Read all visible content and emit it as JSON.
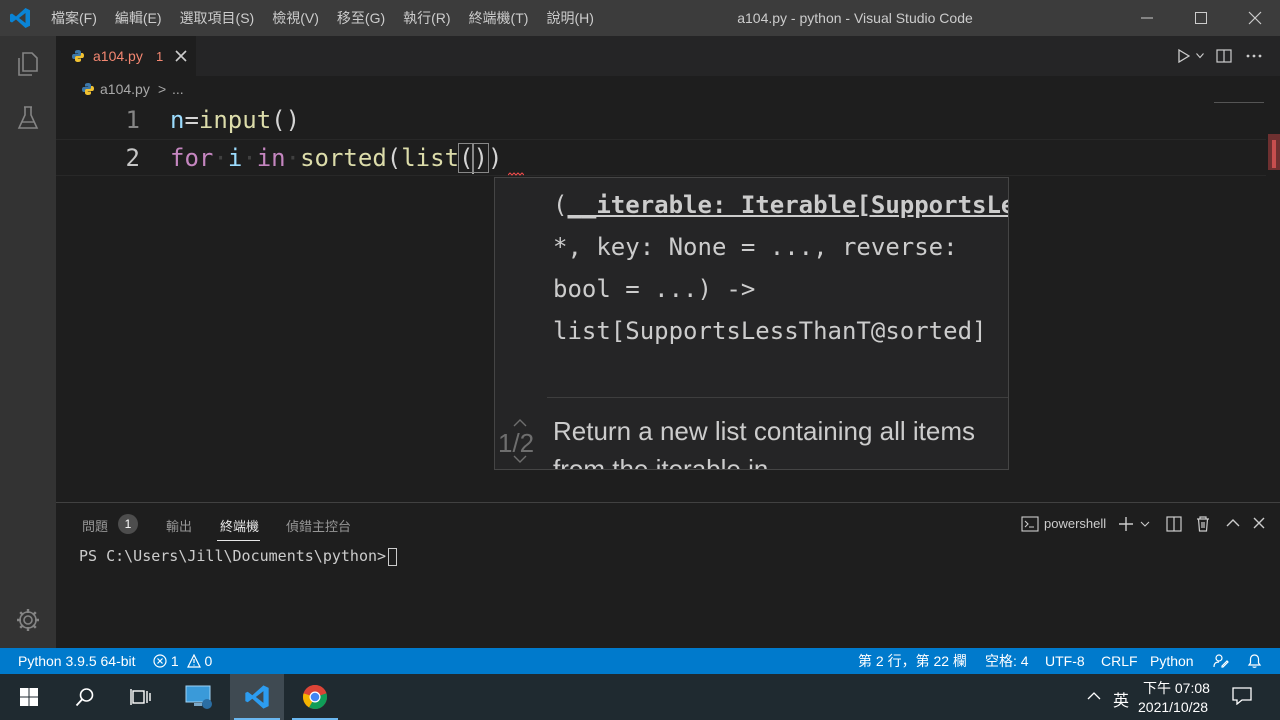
{
  "window": {
    "title": "a104.py - python - Visual Studio Code",
    "menu": [
      "檔案(F)",
      "編輯(E)",
      "選取項目(S)",
      "檢視(V)",
      "移至(G)",
      "執行(R)",
      "終端機(T)",
      "說明(H)"
    ]
  },
  "tab": {
    "filename": "a104.py",
    "problem_count": "1"
  },
  "breadcrumb": {
    "file": "a104.py",
    "separator": ">",
    "more": "..."
  },
  "editor": {
    "lines": [
      {
        "number": "1",
        "tokens": [
          {
            "t": "n",
            "c": "var"
          },
          {
            "t": "=",
            "c": ""
          },
          {
            "t": "input",
            "c": "fn"
          },
          {
            "t": "()",
            "c": ""
          }
        ]
      },
      {
        "number": "2"
      }
    ],
    "line2": {
      "kw_for": "for",
      "var_i": "i",
      "kw_in": "in",
      "fn_sorted": "sorted",
      "open1": "(",
      "fn_list": "list",
      "open2": "(",
      "close2": ")",
      "close1": ")"
    }
  },
  "signature_help": {
    "param_active": "__iterable: Iterable[SupportsLessThanT@sor",
    "line_open": "(",
    "line3": "*, key: None = ..., reverse:",
    "line4": "bool = ...) ->",
    "line5": "list[SupportsLessThanT@sorted]",
    "counter": "1/2",
    "doc": "Return a new list containing all items from the iterable in"
  },
  "panel": {
    "tabs": [
      "問題",
      "輸出",
      "終端機",
      "偵錯主控台"
    ],
    "active_tab": "終端機",
    "problems_badge": "1",
    "shell": "powershell",
    "terminal_prompt": "PS C:\\Users\\Jill\\Documents\\python>"
  },
  "statusbar": {
    "interpreter": "Python 3.9.5 64-bit",
    "errors": "1",
    "warnings": "0",
    "cursor_position": "第 2 行，第 22 欄",
    "indent": "空格: 4",
    "encoding": "UTF-8",
    "eol": "CRLF",
    "language": "Python"
  },
  "taskbar": {
    "ime": "英",
    "time": "下午 07:08",
    "date": "2021/10/28"
  },
  "colors": {
    "accent": "#007acc",
    "error": "#f48771",
    "keyword": "#c586c0",
    "function": "#dcdcaa",
    "variable": "#9cdcfe"
  },
  "icons": [
    "vscode-logo-icon",
    "explorer-icon",
    "testing-flask-icon",
    "settings-gear-icon",
    "python-file-icon",
    "close-icon",
    "run-icon",
    "split-editor-icon",
    "more-actions-icon",
    "terminal-icon",
    "add-icon",
    "trash-icon",
    "maximize-panel-icon",
    "error-icon",
    "warning-icon",
    "feedback-icon",
    "bell-icon",
    "windows-start-icon",
    "search-icon",
    "task-view-icon",
    "chrome-icon"
  ]
}
